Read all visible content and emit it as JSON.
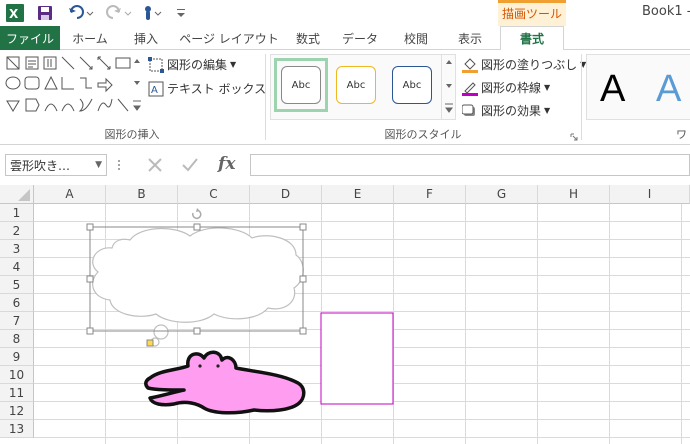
{
  "title_bar": {
    "book_title": "Book1 -",
    "context_tab": "描画ツール"
  },
  "tabs": [
    {
      "label": "ファイル"
    },
    {
      "label": "ホーム"
    },
    {
      "label": "挿入"
    },
    {
      "label": "ページ レイアウト"
    },
    {
      "label": "数式"
    },
    {
      "label": "データ"
    },
    {
      "label": "校閲"
    },
    {
      "label": "表示"
    },
    {
      "label": "書式"
    }
  ],
  "ribbon": {
    "insert_shapes": {
      "edit_shape": "図形の編集",
      "text_box": "テキスト ボックス",
      "group_label": "図形の挿入"
    },
    "shape_styles": {
      "style_labels": [
        "Abc",
        "Abc",
        "Abc"
      ],
      "fill": "図形の塗りつぶし",
      "outline": "図形の枠線",
      "effects": "図形の効果",
      "group_label": "図形のスタイル"
    },
    "wordart": {
      "sample": "A",
      "group_label": "ワ"
    }
  },
  "formula_bar": {
    "name_box": "雲形吹き…",
    "fx": "fx",
    "value": ""
  },
  "grid": {
    "columns": [
      "A",
      "B",
      "C",
      "D",
      "E",
      "F",
      "G",
      "H",
      "I"
    ],
    "rows": [
      "1",
      "2",
      "3",
      "4",
      "5",
      "6",
      "7",
      "8",
      "9",
      "10",
      "11",
      "12",
      "13"
    ]
  },
  "colors": {
    "excel_green": "#217346",
    "context_orange": "#d35400",
    "shape_pink": "#ff9ef0",
    "rect_border": "#c000c0",
    "selection_style": "#9ed3b0"
  }
}
